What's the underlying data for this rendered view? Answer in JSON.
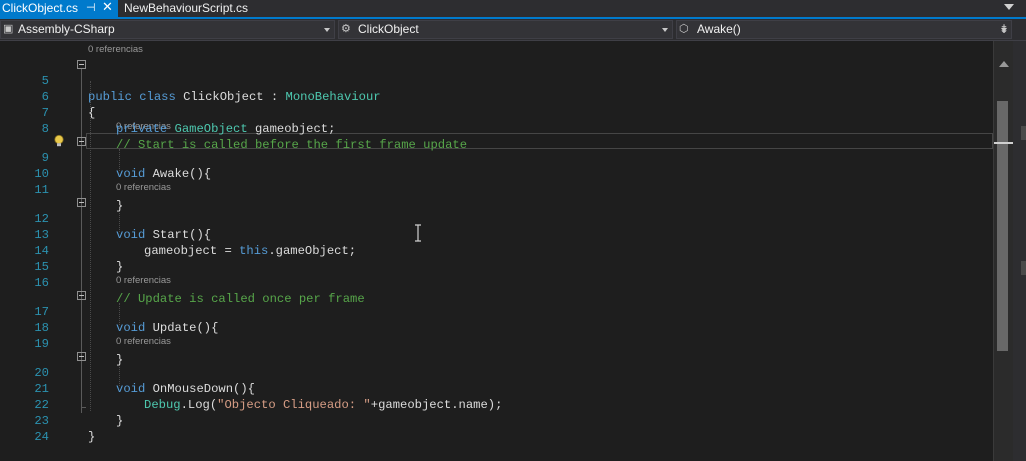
{
  "tabs": {
    "active": {
      "label": "ClickObject.cs"
    },
    "inactive": {
      "label": "NewBehaviourScript.cs"
    }
  },
  "nav": {
    "project": "Assembly-CSharp",
    "type": "ClickObject",
    "member": "Awake()"
  },
  "codelens": "0 referencias",
  "lines": {
    "l5": {
      "num": "5",
      "kw1": "public",
      "kw2": "class",
      "name": "ClickObject",
      "sep": " : ",
      "base": "MonoBehaviour"
    },
    "l6": {
      "num": "6",
      "text": "{"
    },
    "l7": {
      "num": "7",
      "kw": "private",
      "type": "GameObject",
      "rest": " gameobject;"
    },
    "l8": {
      "num": "8",
      "comment": "// Start is called before the first frame update"
    },
    "l9": {
      "num": "9",
      "kw": "void",
      "name": "Awake",
      "rest": "(){"
    },
    "l10": {
      "num": "10"
    },
    "l11": {
      "num": "11",
      "text": "}"
    },
    "l12": {
      "num": "12",
      "kw": "void",
      "name": "Start",
      "rest": "(){"
    },
    "l13": {
      "num": "13",
      "pre": "gameobject = ",
      "kw": "this",
      "rest": ".gameObject;"
    },
    "l14": {
      "num": "14",
      "text": "}"
    },
    "l15": {
      "num": "15"
    },
    "l16": {
      "num": "16",
      "comment": "// Update is called once per frame"
    },
    "l17": {
      "num": "17",
      "kw": "void",
      "name": "Update",
      "rest": "(){"
    },
    "l18": {
      "num": "18"
    },
    "l19": {
      "num": "19",
      "text": "}"
    },
    "l20": {
      "num": "20",
      "kw": "void",
      "name": "OnMouseDown",
      "rest": "(){"
    },
    "l21": {
      "num": "21",
      "type": "Debug",
      "pre": ".Log(",
      "str": "\"Objecto Cliqueado: \"",
      "rest": "+gameobject.name);"
    },
    "l22": {
      "num": "22",
      "text": "}"
    },
    "l23": {
      "num": "23",
      "text": "}"
    },
    "l24": {
      "num": "24"
    }
  },
  "colors": {
    "keyword": "#569cd6",
    "type": "#4ec9b0",
    "comment": "#57a64a",
    "string": "#d69d85",
    "line_number": "#2b91af",
    "accent": "#007acc"
  },
  "icons": {
    "pin": "pin-icon",
    "close": "close-icon",
    "lightbulb": "lightbulb-icon",
    "split": "split-window-icon"
  }
}
